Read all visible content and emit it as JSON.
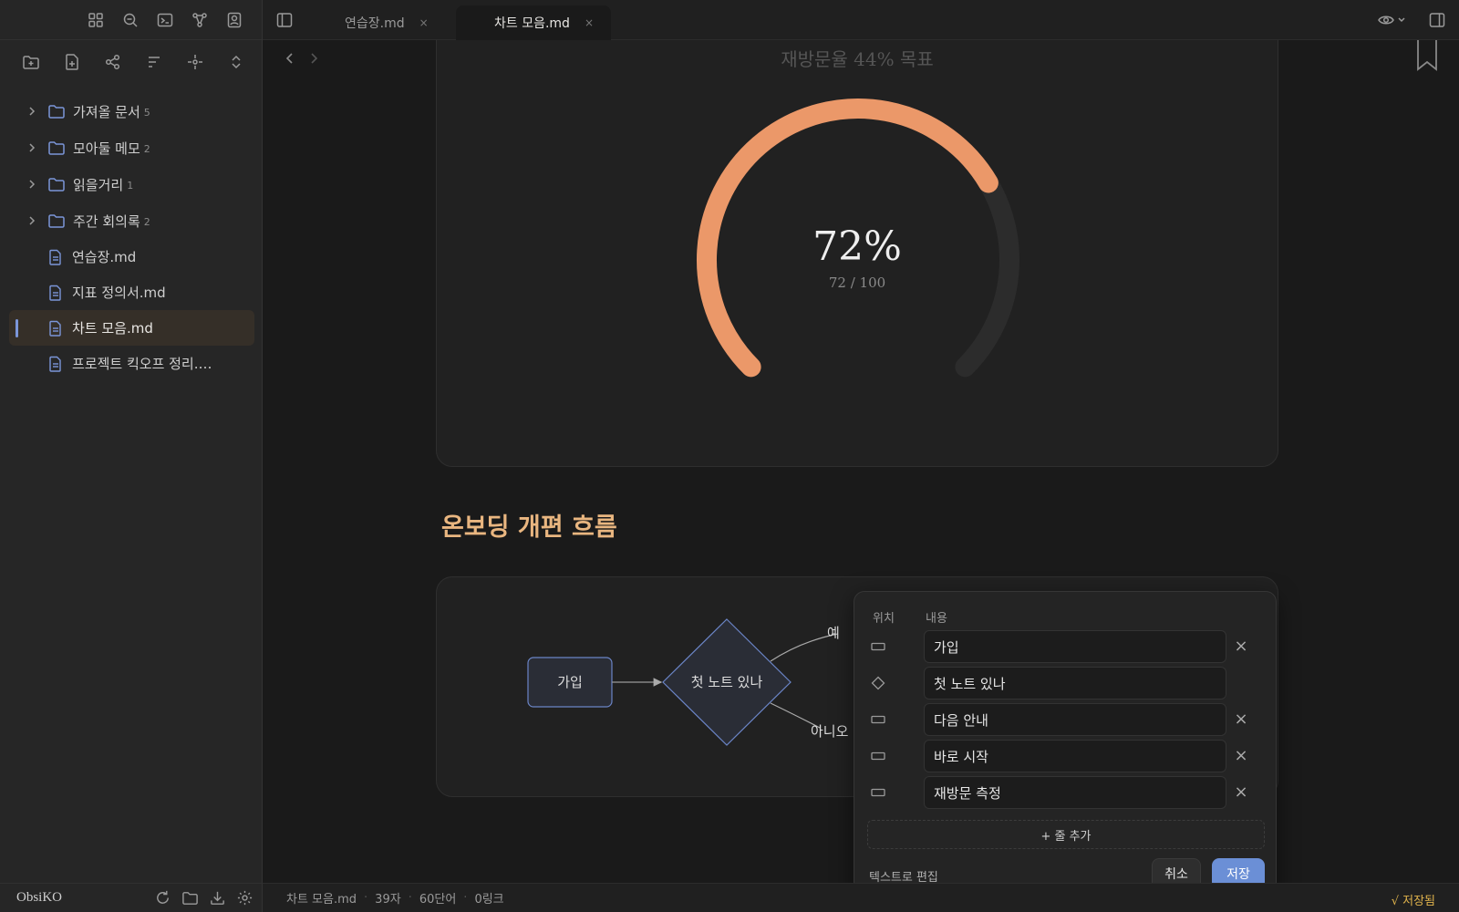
{
  "sidebar": {
    "ribbon_icons": [
      "dashboard-icon",
      "search-icon",
      "terminal-icon",
      "graph-icon",
      "profile-icon"
    ],
    "actions": [
      "new-folder-icon",
      "new-note-icon",
      "graph-view-icon",
      "sort-icon",
      "focus-icon",
      "expand-collapse-icon"
    ],
    "folders": [
      {
        "label": "가져올 문서",
        "count": "5"
      },
      {
        "label": "모아둘 메모",
        "count": "2"
      },
      {
        "label": "읽을거리",
        "count": "1"
      },
      {
        "label": "주간 회의록",
        "count": "2"
      }
    ],
    "files": [
      {
        "label": "연습장.md"
      },
      {
        "label": "지표 정의서.md"
      },
      {
        "label": "차트 모음.md"
      },
      {
        "label": "프로젝트 킥오프 정리.…"
      }
    ],
    "vault_name": "ObsiKO"
  },
  "tabs": [
    {
      "label": "연습장.md",
      "close": "×"
    },
    {
      "label": "차트 모음.md",
      "close": "×"
    }
  ],
  "gauge": {
    "title": "재방문율 44% 목표",
    "value_text": "72%",
    "sub_text": "72 / 100",
    "value": 72,
    "max": 100,
    "accent": "#eb9869",
    "track": "#2c2c2c"
  },
  "section": {
    "heading": "온보딩 개편 흐름"
  },
  "flow": {
    "node_signup": "가입",
    "node_decision": "첫 노트 있나",
    "edge_yes": "예",
    "edge_no": "아니오"
  },
  "editor": {
    "col_position": "위치",
    "col_content": "내용",
    "rows": [
      {
        "shape": "rect",
        "value": "가입",
        "deletable": true
      },
      {
        "shape": "diamond",
        "value": "첫 노트 있나",
        "deletable": false
      },
      {
        "shape": "rect",
        "value": "다음 안내",
        "deletable": true
      },
      {
        "shape": "rect",
        "value": "바로 시작",
        "deletable": true
      },
      {
        "shape": "rect",
        "value": "재방문 측정",
        "deletable": true
      }
    ],
    "delete_glyph": "×",
    "add_row": "+ 줄 추가",
    "text_edit": "텍스트로 편집",
    "cancel": "취소",
    "save": "저장"
  },
  "status": {
    "file": "차트 모음.md",
    "chars": "39자",
    "words": "60단어",
    "links": "0링크",
    "saved": "√ 저장됨"
  }
}
